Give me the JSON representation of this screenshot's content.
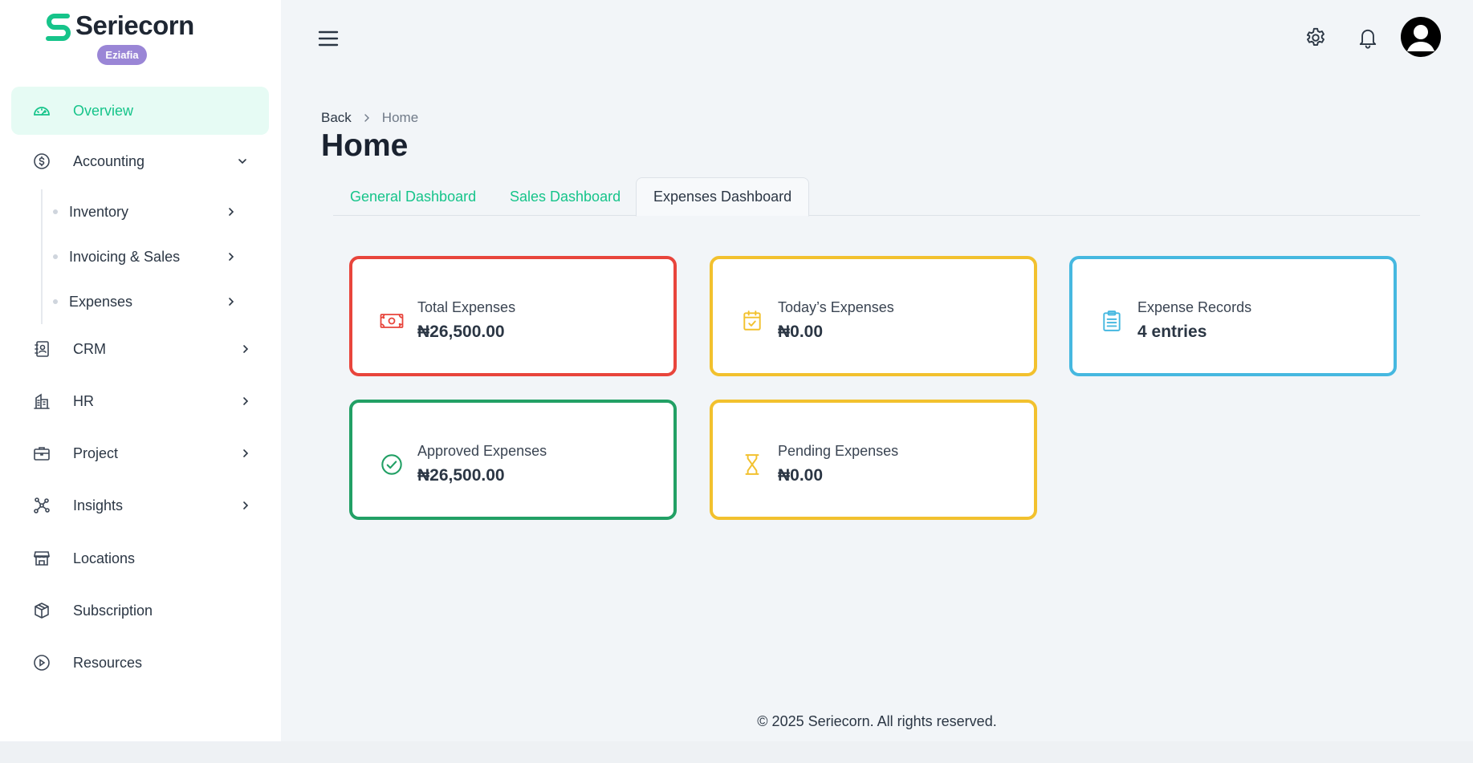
{
  "brand": {
    "name": "Seriecorn",
    "org_badge": "Eziafia",
    "accent": "#16c48a",
    "badge_color": "#9a86d6"
  },
  "sidebar": {
    "items": [
      {
        "label": "Overview",
        "icon": "gauge-icon",
        "active": true
      },
      {
        "label": "Accounting",
        "icon": "dollar-circle-icon",
        "expanded": true
      },
      {
        "label": "CRM",
        "icon": "contact-book-icon"
      },
      {
        "label": "HR",
        "icon": "building-icon"
      },
      {
        "label": "Project",
        "icon": "briefcase-icon"
      },
      {
        "label": "Insights",
        "icon": "network-icon"
      },
      {
        "label": "Locations",
        "icon": "store-icon"
      },
      {
        "label": "Subscription",
        "icon": "package-icon"
      },
      {
        "label": "Resources",
        "icon": "play-circle-icon"
      }
    ],
    "accounting_sub": [
      {
        "label": "Inventory"
      },
      {
        "label": "Invoicing & Sales"
      },
      {
        "label": "Expenses"
      }
    ]
  },
  "header": {
    "menu_icon": "hamburger-icon",
    "settings_icon": "gear-icon",
    "notifications_icon": "bell-icon",
    "avatar_icon": "user-avatar-icon"
  },
  "breadcrumb": {
    "back": "Back",
    "current": "Home"
  },
  "page": {
    "title": "Home"
  },
  "tabs": [
    {
      "label": "General Dashboard",
      "active": false
    },
    {
      "label": "Sales Dashboard",
      "active": false
    },
    {
      "label": "Expenses Dashboard",
      "active": true
    }
  ],
  "cards": [
    {
      "label": "Total Expenses",
      "value": "₦26,500.00",
      "color": "#e8453c",
      "icon": "banknote-icon"
    },
    {
      "label": "Today’s Expenses",
      "value": "₦0.00",
      "color": "#f2c12e",
      "icon": "calendar-check-icon"
    },
    {
      "label": "Expense Records",
      "value": "4 entries",
      "color": "#46b8e0",
      "icon": "clipboard-icon"
    },
    {
      "label": "Approved Expenses",
      "value": "₦26,500.00",
      "color": "#22a065",
      "icon": "check-circle-icon"
    },
    {
      "label": "Pending Expenses",
      "value": "₦0.00",
      "color": "#f2c12e",
      "icon": "hourglass-icon"
    }
  ],
  "footer": {
    "text": "© 2025 Seriecorn. All rights reserved."
  }
}
